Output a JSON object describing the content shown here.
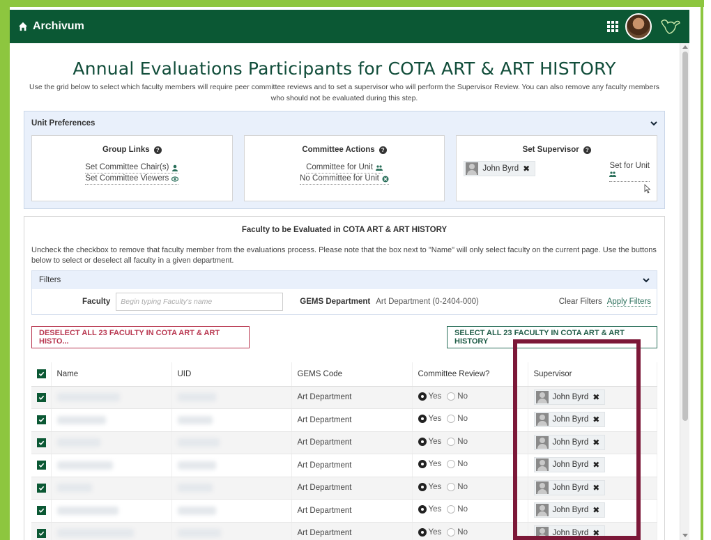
{
  "app": {
    "name": "Archivum"
  },
  "page": {
    "title": "Annual Evaluations Participants for COTA ART & ART HISTORY",
    "intro": "Use the grid below to select which faculty members will require peer committee reviews and to set a supervisor who will perform the Supervisor Review. You can also remove any faculty members who should not be evaluated during this step."
  },
  "unit_preferences": {
    "heading": "Unit Preferences",
    "group_links": {
      "title": "Group Links",
      "set_chairs": "Set Committee Chair(s)",
      "set_viewers": "Set Committee Viewers"
    },
    "committee_actions": {
      "title": "Committee Actions",
      "committee_for_unit": "Committee for Unit",
      "no_committee_for_unit": "No Committee for Unit"
    },
    "set_supervisor": {
      "title": "Set Supervisor",
      "supervisor_name": "John Byrd",
      "set_for_unit": "Set for Unit"
    }
  },
  "faculty_section": {
    "title": "Faculty to be Evaluated in COTA ART & ART HISTORY",
    "description": "Uncheck the checkbox to remove that faculty member from the evaluations process. Please note that the box next to \"Name\" will only select faculty on the current page. Use the buttons below to select or deselect all faculty in a given department.",
    "filters": {
      "heading": "Filters",
      "faculty_label": "Faculty",
      "faculty_placeholder": "Begin typing Faculty's name",
      "gems_label": "GEMS Department",
      "gems_value": "Art Department (0-2404-000)",
      "clear": "Clear Filters",
      "apply": "Apply Filters"
    },
    "deselect_all": "DESELECT ALL 23 FACULTY IN COTA ART & ART HISTO...",
    "select_all": "SELECT ALL 23 FACULTY IN COTA ART & ART HISTORY"
  },
  "table": {
    "columns": [
      "Name",
      "UID",
      "GEMS Code",
      "Committee Review?",
      "Supervisor"
    ],
    "yes_label": "Yes",
    "no_label": "No",
    "rows": [
      {
        "gems": "Art Department",
        "review": "Yes",
        "supervisor": "John Byrd"
      },
      {
        "gems": "Art Department",
        "review": "Yes",
        "supervisor": "John Byrd"
      },
      {
        "gems": "Art Department",
        "review": "Yes",
        "supervisor": "John Byrd"
      },
      {
        "gems": "Art Department",
        "review": "Yes",
        "supervisor": "John Byrd"
      },
      {
        "gems": "Art Department",
        "review": "Yes",
        "supervisor": "John Byrd"
      },
      {
        "gems": "Art Department",
        "review": "Yes",
        "supervisor": "John Byrd"
      },
      {
        "gems": "Art Department",
        "review": "Yes",
        "supervisor": "John Byrd"
      }
    ]
  },
  "colors": {
    "header_green": "#0b5834",
    "frame_green": "#8dc63f",
    "highlight": "#7c1838",
    "deselect_red": "#b8364f"
  }
}
